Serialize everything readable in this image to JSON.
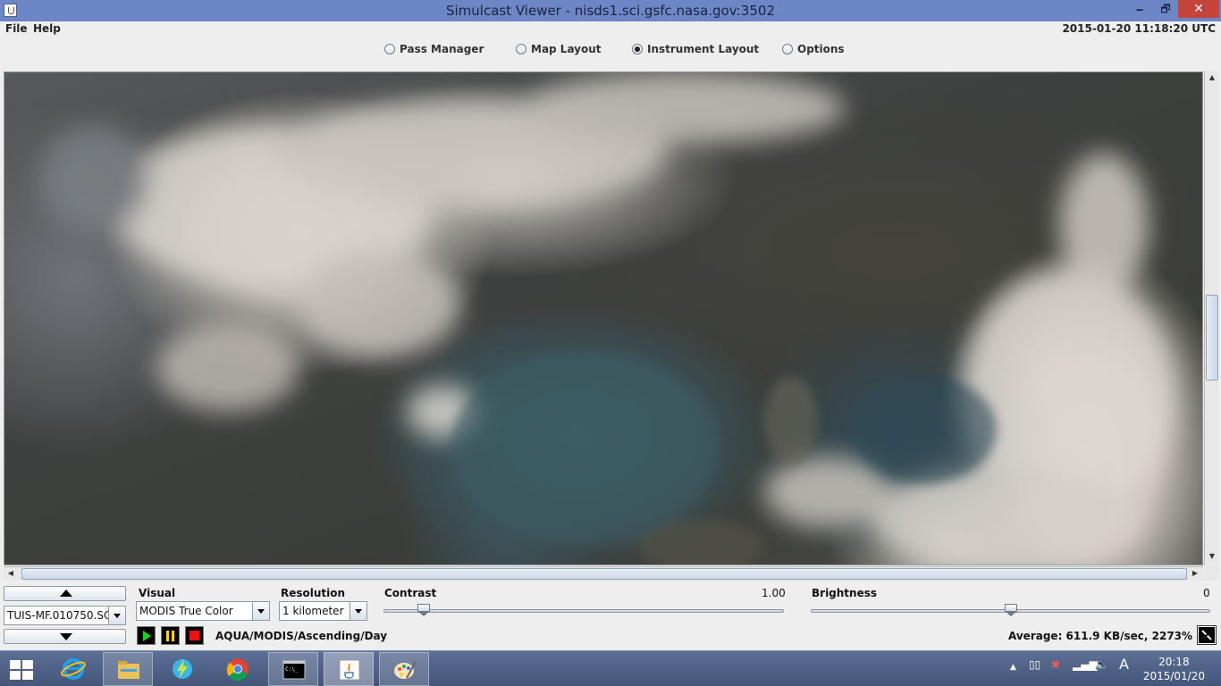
{
  "window": {
    "title": "Simulcast Viewer - nisds1.sci.gsfc.nasa.gov:3502",
    "minimize": "🗕",
    "maximize": "🗗",
    "close": "✕"
  },
  "menu": {
    "file": "File",
    "help": "Help"
  },
  "utc_clock": "2015-01-20 11:18:20 UTC",
  "tabs": [
    {
      "label": "Pass Manager",
      "selected": false
    },
    {
      "label": "Map Layout",
      "selected": false
    },
    {
      "label": "Instrument Layout",
      "selected": true
    },
    {
      "label": "Options",
      "selected": false
    }
  ],
  "image_view": {
    "icon": "satellite-imagery"
  },
  "controls": {
    "pass_select": "TUIS-MF.010750.SC",
    "visual_label": "Visual",
    "visual_value": "MODIS True Color",
    "resolution_label": "Resolution",
    "resolution_value": "1 kilometer",
    "contrast_label": "Contrast",
    "contrast_value": "1.00",
    "contrast_fraction": 0.1,
    "brightness_label": "Brightness",
    "brightness_value": "0",
    "brightness_fraction": 0.5,
    "stream_info": "AQUA/MODIS/Ascending/Day",
    "throughput": "Average: 611.9 KB/sec, 2273%"
  },
  "taskbar": {
    "apps": [
      {
        "icon": "internet-explorer-icon",
        "active": false
      },
      {
        "icon": "file-explorer-icon",
        "active": false
      },
      {
        "icon": "bolt-app-icon",
        "active": false
      },
      {
        "icon": "chrome-icon",
        "active": false
      },
      {
        "icon": "command-prompt-icon",
        "active": false
      },
      {
        "icon": "java-icon",
        "active": true
      },
      {
        "icon": "paint-icon",
        "active": false
      }
    ],
    "ime": "A",
    "time": "20:18",
    "date": "2015/01/20"
  },
  "colors": {
    "titlebar": "#6d87c6",
    "close_red": "#c7443a",
    "taskbar": "#4b5d82"
  }
}
